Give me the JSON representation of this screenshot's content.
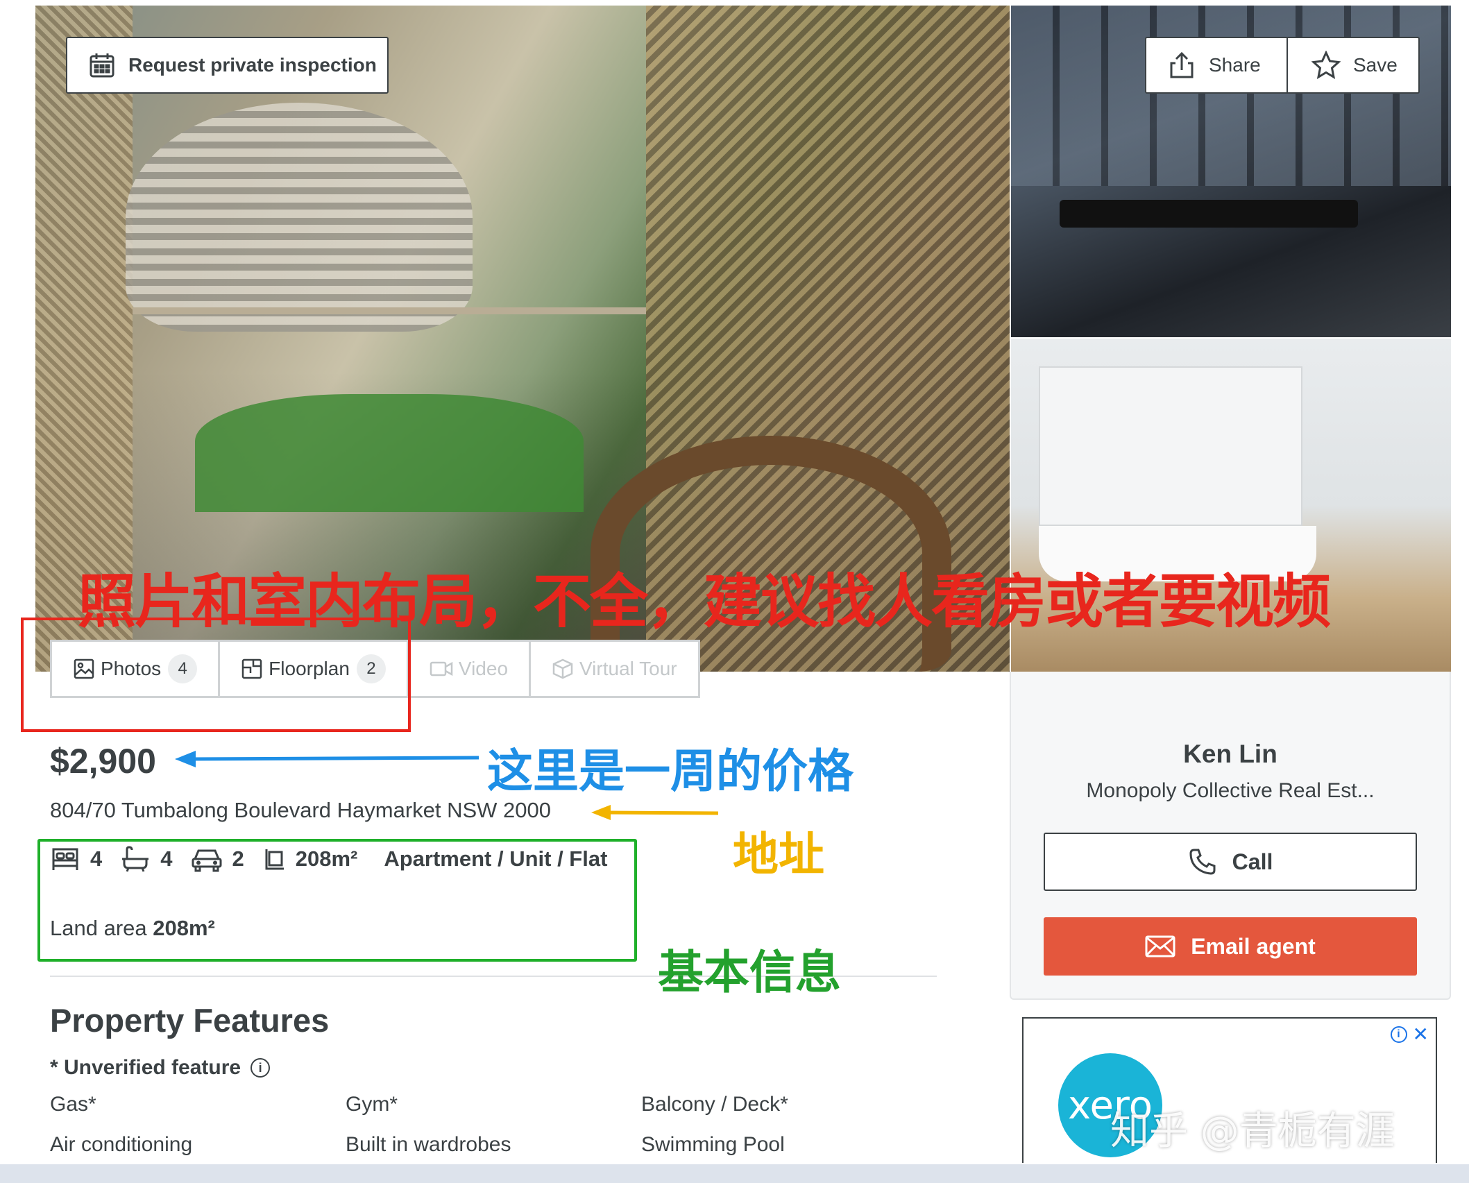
{
  "header": {
    "inspect_label": "Request private inspection",
    "share_label": "Share",
    "save_label": "Save"
  },
  "media_tabs": [
    {
      "label": "Photos",
      "count": "4",
      "icon": "image-icon",
      "enabled": true
    },
    {
      "label": "Floorplan",
      "count": "2",
      "icon": "floorplan-icon",
      "enabled": true
    },
    {
      "label": "Video",
      "icon": "video-icon",
      "enabled": false
    },
    {
      "label": "Virtual Tour",
      "icon": "cube-icon",
      "enabled": false
    }
  ],
  "listing": {
    "price": "$2,900",
    "address": "804/70 Tumbalong Boulevard Haymarket NSW 2000",
    "beds": "4",
    "baths": "4",
    "parking": "2",
    "size": "208m²",
    "property_type": "Apartment / Unit / Flat",
    "land_area_label": "Land area",
    "land_area_value": "208m²"
  },
  "features": {
    "title": "Property Features",
    "unverified_label": "* Unverified feature",
    "info_symbol": "i",
    "items": [
      "Gas*",
      "Gym*",
      "Balcony / Deck*",
      "Air conditioning",
      "Built in wardrobes",
      "Swimming Pool"
    ]
  },
  "agent": {
    "name": "Ken Lin",
    "agency": "Monopoly Collective Real Est...",
    "call_label": "Call",
    "email_label": "Email agent"
  },
  "ad": {
    "brand": "xero",
    "info_symbol": "i",
    "close_symbol": "✕"
  },
  "annotations": {
    "red": "照片和室内布局，不全，建议找人看房或者要视频",
    "blue": "这里是一周的价格",
    "yellow": "地址",
    "green": "基本信息"
  },
  "watermark": "知乎 @青栀有涯",
  "colors": {
    "accent_email": "#e4573d",
    "text": "#3b4144",
    "anno_red": "#e8261d",
    "anno_blue": "#1e8fe6",
    "anno_yellow": "#f2b400",
    "anno_green": "#23a12d"
  }
}
